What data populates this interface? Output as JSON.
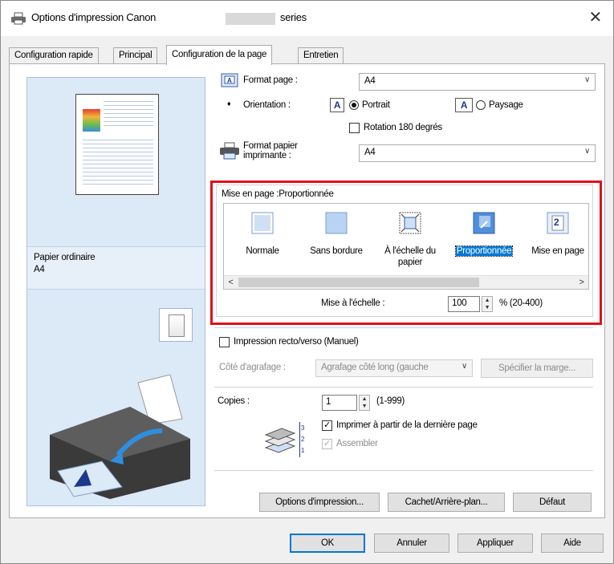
{
  "window": {
    "title": "Options d'impression Canon",
    "title_suffix": "series",
    "close_symbol": "✕"
  },
  "tabs": [
    {
      "label": "Configuration rapide",
      "active": false
    },
    {
      "label": "Principal",
      "active": false
    },
    {
      "label": "Configuration de la page",
      "active": true
    },
    {
      "label": "Entretien",
      "active": false
    }
  ],
  "preview": {
    "media_type": "Papier ordinaire",
    "media_size": "A4"
  },
  "page": {
    "format_label": "Format page :",
    "format_value": "A4",
    "orientation_label": "Orientation :",
    "portrait_label": "Portrait",
    "landscape_label": "Paysage",
    "orientation_selected": "portrait",
    "rotate_label": "Rotation 180 degrés",
    "rotate_checked": false,
    "printer_paper_label_1": "Format papier",
    "printer_paper_label_2": "imprimante :",
    "printer_paper_value": "A4"
  },
  "layout": {
    "title": "Mise en page :Proportionnée",
    "items": [
      {
        "line1": "Normale",
        "line2": ""
      },
      {
        "line1": "Sans bordure",
        "line2": ""
      },
      {
        "line1": "À l'échelle du",
        "line2": "papier"
      },
      {
        "line1": "Proportionnée",
        "line2": "",
        "selected": true
      },
      {
        "line1": "Mise en page",
        "line2": ""
      }
    ],
    "pages_icon_text": "2",
    "scale_label": "Mise à l'échelle :",
    "scale_value": "100",
    "scale_range": "% (20-400)"
  },
  "duplex": {
    "label": "Impression recto/verso (Manuel)",
    "checked": false,
    "stapling_label": "Côté d'agrafage :",
    "stapling_value": "Agrafage côté long (gauche",
    "margin_button": "Spécifier la marge..."
  },
  "copies": {
    "label": "Copies :",
    "value": "1",
    "range": "(1-999)",
    "reverse_label": "Imprimer à partir de la dernière page",
    "reverse_checked": true,
    "collate_label": "Assembler",
    "collate_checked": true
  },
  "panel_buttons": {
    "print_options": "Options d'impression...",
    "stamp": "Cachet/Arrière-plan...",
    "defaults": "Défaut"
  },
  "footer": {
    "ok": "OK",
    "cancel": "Annuler",
    "apply": "Appliquer",
    "help": "Aide"
  },
  "colors": {
    "highlight": "#0078d7",
    "annotation": "#e0101a",
    "preview_bg": "#dce9f6"
  }
}
